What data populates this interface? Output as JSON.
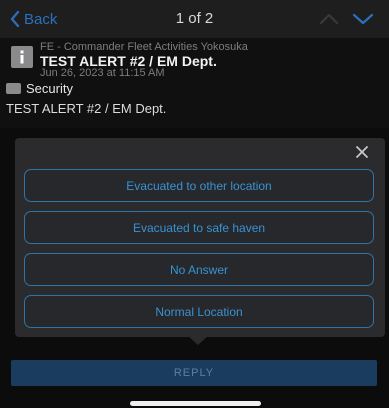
{
  "nav": {
    "back_label": "Back",
    "counter": "1 of 2"
  },
  "message": {
    "sender": "FE - Commander Fleet Activities Yokosuka",
    "title": "TEST ALERT #2 / EM Dept.",
    "date": "Jun 26, 2023 at 11:15 AM",
    "category": "Security",
    "body": "TEST ALERT #2 / EM Dept."
  },
  "popup": {
    "options": [
      "Evacuated to other location",
      "Evacuated to safe haven",
      "No Answer",
      "Normal Location"
    ]
  },
  "reply_label": "REPLY",
  "colors": {
    "accent": "#2c6fbe",
    "option_border": "#2e74a8",
    "option_text": "#3a92d2",
    "reply_bg": "#1a3d5f"
  }
}
